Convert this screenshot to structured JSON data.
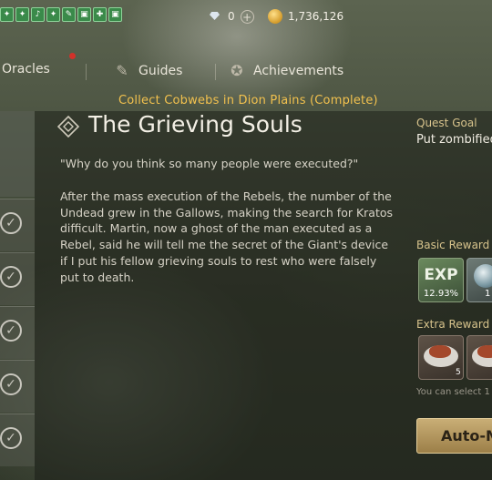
{
  "buffs": [
    "✦",
    "✦",
    "♪",
    "✦",
    "✎",
    "▣",
    "✚",
    "▣"
  ],
  "currency": {
    "gems": "0",
    "gold": "1,736,126"
  },
  "nav": {
    "tabs": [
      {
        "label": "Oracles"
      },
      {
        "label": "Guides"
      },
      {
        "label": "Achievements"
      }
    ]
  },
  "banner": "Collect Cobwebs in Dion Plains (Complete)",
  "quest": {
    "title": "The Grieving Souls",
    "quote": "\"Why do you think so many people were executed?\"",
    "description": "After the mass execution of the Rebels, the number of the Undead grew in the Gallows, making the search for Kratos difficult. Martin, now a ghost of the man executed as a Rebel, said he will tell me the secret of the Giant's device if I put his fellow grieving souls to rest who were falsely put to death."
  },
  "goal": {
    "label": "Quest Goal",
    "text": "Put zombified"
  },
  "basic_reward": {
    "label": "Basic Reward",
    "exp_label": "EXP",
    "exp_value": "12.93%",
    "item2_value": "1"
  },
  "extra_reward": {
    "label": "Extra Reward",
    "items": [
      {
        "count": "5"
      },
      {
        "count": ""
      }
    ],
    "hint": "You can select 1"
  },
  "auto_button": "Auto-M"
}
